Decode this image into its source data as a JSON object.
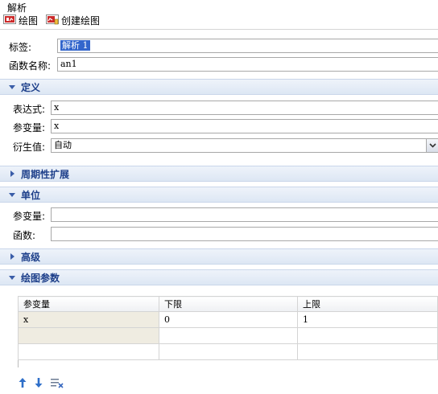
{
  "window": {
    "title": "解析"
  },
  "toolbar": {
    "plot_label": "绘图",
    "create_plot_label": "创建绘图"
  },
  "fields": {
    "label_caption": "标签:",
    "label_value": "解析 1",
    "funcname_caption": "函数名称:",
    "funcname_value": "an1"
  },
  "definition": {
    "header": "定义",
    "expression_caption": "表达式:",
    "expression_value": "x",
    "argument_caption": "参变量:",
    "argument_value": "x",
    "derivative_caption": "衍生值:",
    "derivative_value": "自动"
  },
  "periodic": {
    "header": "周期性扩展"
  },
  "units": {
    "header": "单位",
    "argument_caption": "参变量:",
    "argument_value": "",
    "function_caption": "函数:",
    "function_value": ""
  },
  "advanced": {
    "header": "高级"
  },
  "plot_params": {
    "header": "绘图参数",
    "columns": [
      "参变量",
      "下限",
      "上限"
    ],
    "rows": [
      [
        "x",
        "0",
        "1"
      ]
    ]
  },
  "icons": [
    "plot-icon",
    "create-plot-icon",
    "move-up-icon",
    "move-down-icon",
    "clear-table-icon",
    "chevron-down-icon"
  ],
  "colors": {
    "section_text": "#1d3f8a",
    "selection": "#3366cc",
    "arrow_blue": "#2f6fc9"
  }
}
